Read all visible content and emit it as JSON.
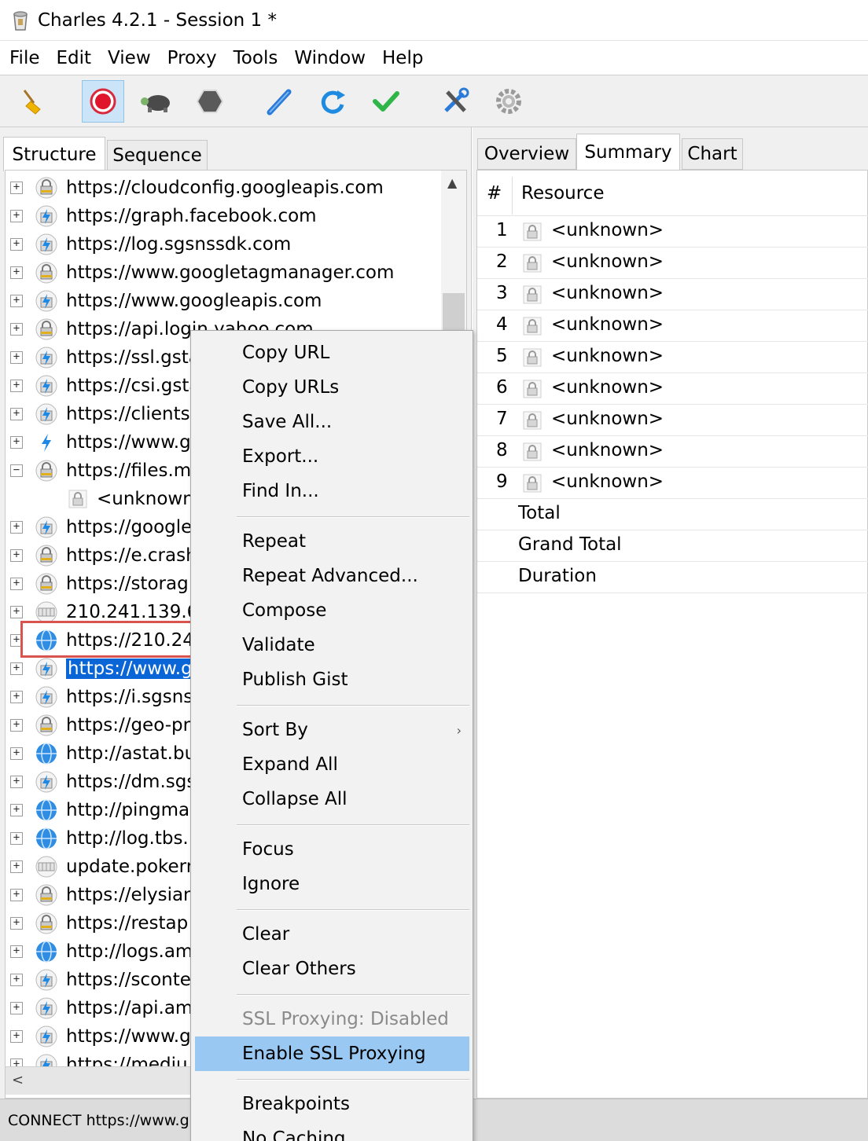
{
  "window": {
    "title": "Charles 4.2.1 - Session 1 *"
  },
  "menubar": [
    "File",
    "Edit",
    "View",
    "Proxy",
    "Tools",
    "Window",
    "Help"
  ],
  "toolbar": {
    "buttons": [
      "broom-clear-icon",
      "record-icon",
      "throttle-turtle-icon",
      "stop-hexagon-icon",
      "compose-pen-icon",
      "repeat-refresh-icon",
      "validate-check-icon",
      "tools-icon",
      "settings-gear-icon"
    ]
  },
  "left": {
    "tabs": [
      "Structure",
      "Sequence"
    ],
    "tree": [
      {
        "label": "https://cloudconfig.googleapis.com",
        "icon": "lock",
        "exp": "+"
      },
      {
        "label": "https://graph.facebook.com",
        "icon": "bolt",
        "exp": "+"
      },
      {
        "label": "https://log.sgsnssdk.com",
        "icon": "bolt",
        "exp": "+"
      },
      {
        "label": "https://www.googletagmanager.com",
        "icon": "lock",
        "exp": "+"
      },
      {
        "label": "https://www.googleapis.com",
        "icon": "bolt",
        "exp": "+"
      },
      {
        "label": "https://api.login.yahoo.com",
        "icon": "lock",
        "exp": "+"
      },
      {
        "label": "https://ssl.gsta",
        "icon": "bolt",
        "exp": "+"
      },
      {
        "label": "https://csi.gsta",
        "icon": "bolt",
        "exp": "+"
      },
      {
        "label": "https://clients",
        "icon": "bolt",
        "exp": "+"
      },
      {
        "label": "https://www.g",
        "icon": "bolt-plain",
        "exp": "+"
      },
      {
        "label": "https://files.m",
        "icon": "lock",
        "exp": "−"
      },
      {
        "label": "<unknown>",
        "icon": "child-lock",
        "exp": ""
      },
      {
        "label": "https://google",
        "icon": "bolt",
        "exp": "+"
      },
      {
        "label": "https://e.crash",
        "icon": "lock",
        "exp": "+"
      },
      {
        "label": "https://storag",
        "icon": "lock",
        "exp": "+"
      },
      {
        "label": "210.241.139.6",
        "icon": "ip",
        "exp": "+"
      },
      {
        "label": "https://210.24",
        "icon": "globe",
        "exp": "+"
      },
      {
        "label": "https://www.g",
        "icon": "bolt",
        "exp": "+",
        "selected": true
      },
      {
        "label": "https://i.sgsns",
        "icon": "bolt",
        "exp": "+"
      },
      {
        "label": "https://geo-pr",
        "icon": "lock",
        "exp": "+"
      },
      {
        "label": "http://astat.bu",
        "icon": "globe",
        "exp": "+"
      },
      {
        "label": "https://dm.sgs",
        "icon": "bolt",
        "exp": "+"
      },
      {
        "label": "http://pingma",
        "icon": "globe",
        "exp": "+"
      },
      {
        "label": "http://log.tbs.",
        "icon": "globe",
        "exp": "+"
      },
      {
        "label": "update.pokerr",
        "icon": "ip",
        "exp": "+"
      },
      {
        "label": "https://elysian",
        "icon": "lock",
        "exp": "+"
      },
      {
        "label": "https://restap",
        "icon": "lock",
        "exp": "+"
      },
      {
        "label": "http://logs.am",
        "icon": "globe",
        "exp": "+"
      },
      {
        "label": "https://sconte",
        "icon": "bolt",
        "exp": "+"
      },
      {
        "label": "https://api.am",
        "icon": "bolt",
        "exp": "+"
      },
      {
        "label": "https://www.g",
        "icon": "bolt",
        "exp": "+"
      },
      {
        "label": "https://mediu",
        "icon": "bolt",
        "exp": "+"
      }
    ]
  },
  "right": {
    "tabs": [
      "Overview",
      "Summary",
      "Chart"
    ],
    "columns": [
      "#",
      "Resource"
    ],
    "rows": [
      {
        "num": "1",
        "resource": "<unknown>"
      },
      {
        "num": "2",
        "resource": "<unknown>"
      },
      {
        "num": "3",
        "resource": "<unknown>"
      },
      {
        "num": "4",
        "resource": "<unknown>"
      },
      {
        "num": "5",
        "resource": "<unknown>"
      },
      {
        "num": "6",
        "resource": "<unknown>"
      },
      {
        "num": "7",
        "resource": "<unknown>"
      },
      {
        "num": "8",
        "resource": "<unknown>"
      },
      {
        "num": "9",
        "resource": "<unknown>"
      }
    ],
    "totals": [
      "Total",
      "Grand Total",
      "Duration"
    ]
  },
  "status": {
    "text": "CONNECT https://www.g"
  },
  "context_menu": {
    "items": [
      {
        "label": "Copy URL"
      },
      {
        "label": "Copy URLs"
      },
      {
        "label": "Save All..."
      },
      {
        "label": "Export..."
      },
      {
        "label": "Find In..."
      },
      {
        "divider": true
      },
      {
        "label": "Repeat"
      },
      {
        "label": "Repeat Advanced..."
      },
      {
        "label": "Compose"
      },
      {
        "label": "Validate"
      },
      {
        "label": "Publish Gist"
      },
      {
        "divider": true
      },
      {
        "label": "Sort By",
        "submenu": true
      },
      {
        "label": "Expand All"
      },
      {
        "label": "Collapse All"
      },
      {
        "divider": true
      },
      {
        "label": "Focus"
      },
      {
        "label": "Ignore"
      },
      {
        "divider": true
      },
      {
        "label": "Clear"
      },
      {
        "label": "Clear Others"
      },
      {
        "divider": true
      },
      {
        "label": "SSL Proxying: Disabled",
        "disabled": true
      },
      {
        "label": "Enable SSL Proxying",
        "highlighted": true
      },
      {
        "divider": true
      },
      {
        "label": "Breakpoints"
      },
      {
        "label": "No Caching"
      }
    ]
  },
  "colors": {
    "selection": "#0a66d6",
    "menu_highlight": "#99c9f3",
    "callout_border": "#d9534f"
  }
}
